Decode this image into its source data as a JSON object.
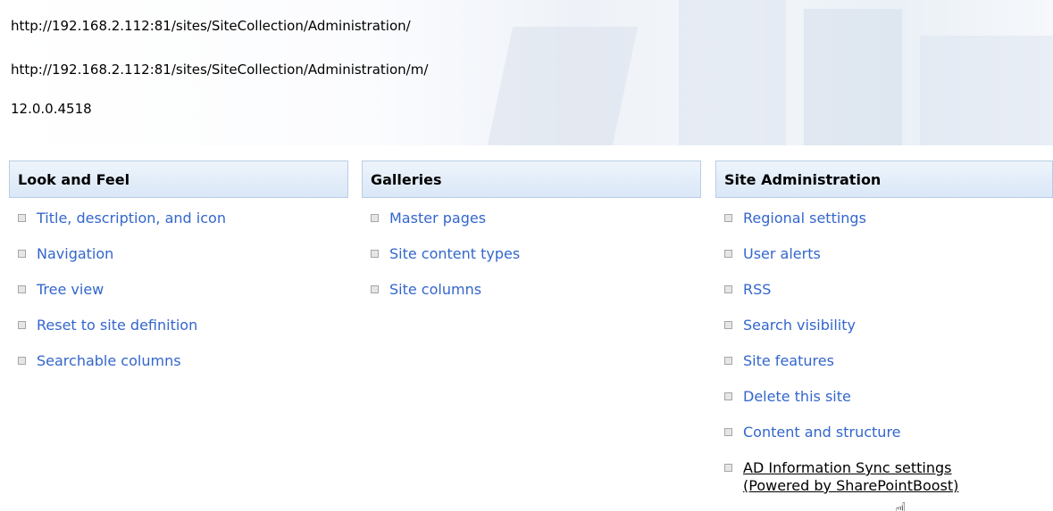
{
  "info": {
    "site_url": "http://192.168.2.112:81/sites/SiteCollection/Administration/",
    "mobile_url": "http://192.168.2.112:81/sites/SiteCollection/Administration/m/",
    "version": "12.0.0.4518"
  },
  "columns": [
    {
      "title": "Look and Feel",
      "items": [
        "Title, description, and icon",
        "Navigation",
        "Tree view",
        "Reset to site definition",
        "Searchable columns"
      ]
    },
    {
      "title": "Galleries",
      "items": [
        "Master pages",
        "Site content types",
        "Site columns"
      ]
    },
    {
      "title": "Site Administration",
      "items": [
        "Regional settings",
        "User alerts",
        "RSS",
        "Search visibility",
        "Site features",
        "Delete this site",
        "Content and structure"
      ],
      "hover_item": {
        "line1": "AD Information Sync settings",
        "line2": "(Powered by SharePointBoost)"
      }
    }
  ],
  "colors": {
    "link": "#3366cc",
    "header_bg": "#d9e7f7",
    "header_border": "#b8cde6"
  }
}
